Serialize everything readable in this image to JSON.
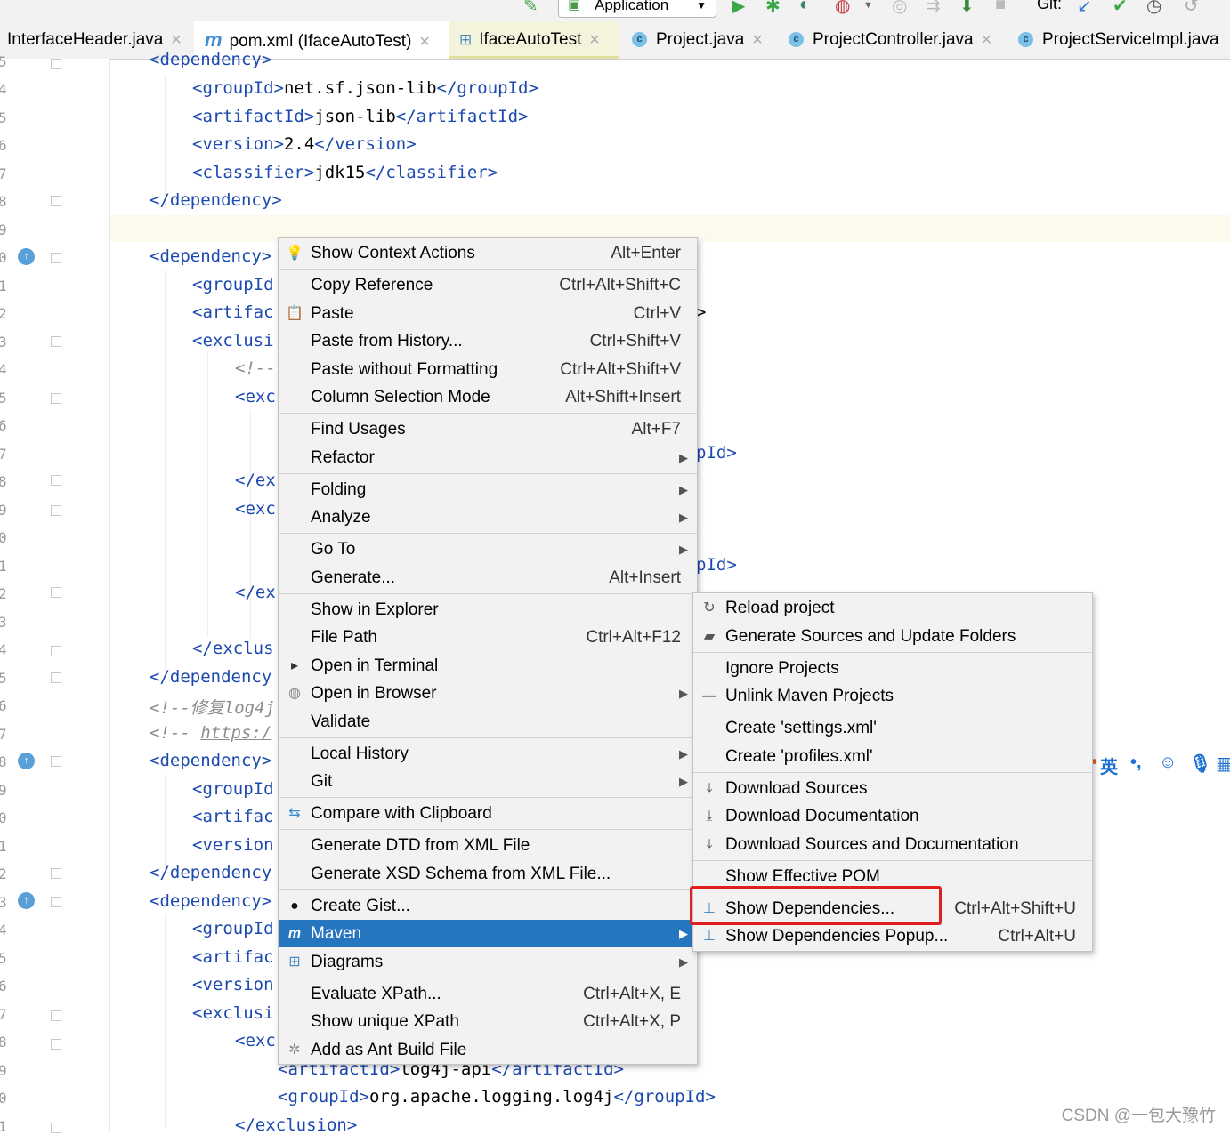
{
  "toolbar": {
    "run_config": "Application",
    "git_label": "Git:"
  },
  "tabs": [
    {
      "label": "InterfaceHeader.java"
    },
    {
      "label": "pom.xml (IfaceAutoTest)"
    },
    {
      "label": "IfaceAutoTest"
    },
    {
      "label": "Project.java"
    },
    {
      "label": "ProjectController.java"
    },
    {
      "label": "ProjectServiceImpl.java"
    }
  ],
  "line_numbers": [
    "5",
    "4",
    "5",
    "6",
    "7",
    "8",
    "9",
    "0",
    "1",
    "2",
    "3",
    "4",
    "5",
    "6",
    "7",
    "8",
    "9",
    "0",
    "1",
    "2",
    "3",
    "4",
    "5",
    "6",
    "7",
    "8",
    "9",
    "0",
    "1",
    "2",
    "3",
    "4",
    "5",
    "6",
    "7",
    "8",
    "9",
    "0",
    "1"
  ],
  "code": {
    "l0": "<dependency>",
    "l1a": "<groupId>",
    "l1b": "net.sf.json-lib",
    "l1c": "</groupId>",
    "l2a": "<artifactId>",
    "l2b": "json-lib",
    "l2c": "</artifactId>",
    "l3a": "<version>",
    "l3b": "2.4",
    "l3c": "</version>",
    "l4a": "<classifier>",
    "l4b": "jdk15",
    "l4c": "</classifier>",
    "l5": "</dependency>",
    "l7": "<dependency>",
    "l8": "<groupId",
    "l9": "<artifac",
    "l10": "<exclusi",
    "l11": "<!--",
    "l12": "<exc",
    "l15": "</ex",
    "l16": "<exc",
    "l19": "</ex",
    "l21": "</exclus",
    "l22": "</dependency",
    "l23": "<!--修复log4j",
    "l24a": "<!-- ",
    "l24b": "https:/",
    "l25": "<dependency>",
    "l26": "<groupId",
    "l27": "<artifac",
    "l28": "<version",
    "l29": "</dependency",
    "l30": "<dependency>",
    "l31": "<groupId",
    "l32": "<artifac",
    "l33": "<version",
    "l34": "<exclusi",
    "l35": "<exc",
    "l36a": "<artifactId>",
    "l36b": "log4j-api",
    "l36c": "</artifactId>",
    "l37a": "<groupId>",
    "l37b": "org.apache.logging.log4j",
    "l37c": "</groupId>",
    "l38": "</exclusion>",
    "frag1": ">",
    "frag2": "pId>",
    "frag3": "pId>"
  },
  "context_menu": [
    {
      "label": "Show Context Actions",
      "shortcut": "Alt+Enter",
      "icon": "bulb-icon"
    },
    {
      "label": "Copy Reference",
      "shortcut": "Ctrl+Alt+Shift+C"
    },
    {
      "label": "Paste",
      "shortcut": "Ctrl+V",
      "icon": "clipboard-icon"
    },
    {
      "label": "Paste from History...",
      "shortcut": "Ctrl+Shift+V"
    },
    {
      "label": "Paste without Formatting",
      "shortcut": "Ctrl+Alt+Shift+V"
    },
    {
      "label": "Column Selection Mode",
      "shortcut": "Alt+Shift+Insert"
    },
    {
      "label": "Find Usages",
      "shortcut": "Alt+F7"
    },
    {
      "label": "Refactor",
      "shortcut": ""
    },
    {
      "label": "Folding",
      "shortcut": ""
    },
    {
      "label": "Analyze",
      "shortcut": ""
    },
    {
      "label": "Go To",
      "shortcut": ""
    },
    {
      "label": "Generate...",
      "shortcut": "Alt+Insert"
    },
    {
      "label": "Show in Explorer",
      "shortcut": ""
    },
    {
      "label": "File Path",
      "shortcut": "Ctrl+Alt+F12"
    },
    {
      "label": "Open in Terminal",
      "shortcut": "",
      "icon": "terminal-icon"
    },
    {
      "label": "Open in Browser",
      "shortcut": "",
      "icon": "globe-icon"
    },
    {
      "label": "Validate",
      "shortcut": ""
    },
    {
      "label": "Local History",
      "shortcut": ""
    },
    {
      "label": "Git",
      "shortcut": ""
    },
    {
      "label": "Compare with Clipboard",
      "shortcut": "",
      "icon": "compare-icon"
    },
    {
      "label": "Generate DTD from XML File",
      "shortcut": ""
    },
    {
      "label": "Generate XSD Schema from XML File...",
      "shortcut": ""
    },
    {
      "label": "Create Gist...",
      "shortcut": "",
      "icon": "github-icon"
    },
    {
      "label": "Maven",
      "shortcut": "",
      "icon": "maven-icon"
    },
    {
      "label": "Diagrams",
      "shortcut": "",
      "icon": "diagram-icon"
    },
    {
      "label": "Evaluate XPath...",
      "shortcut": "Ctrl+Alt+X, E"
    },
    {
      "label": "Show unique XPath",
      "shortcut": "Ctrl+Alt+X, P"
    },
    {
      "label": "Add as Ant Build File",
      "shortcut": "",
      "icon": "ant-icon"
    }
  ],
  "maven_submenu": [
    {
      "label": "Reload project",
      "shortcut": "",
      "icon": "reload-icon"
    },
    {
      "label": "Generate Sources and Update Folders",
      "shortcut": "",
      "icon": "generate-sources-icon"
    },
    {
      "label": "Ignore Projects",
      "shortcut": ""
    },
    {
      "label": "Unlink Maven Projects",
      "shortcut": "",
      "icon": "minus-icon"
    },
    {
      "label": "Create 'settings.xml'",
      "shortcut": ""
    },
    {
      "label": "Create 'profiles.xml'",
      "shortcut": ""
    },
    {
      "label": "Download Sources",
      "shortcut": "",
      "icon": "download-icon"
    },
    {
      "label": "Download Documentation",
      "shortcut": "",
      "icon": "download-icon"
    },
    {
      "label": "Download Sources and Documentation",
      "shortcut": "",
      "icon": "download-icon"
    },
    {
      "label": "Show Effective POM",
      "shortcut": ""
    },
    {
      "label": "Show Dependencies...",
      "shortcut": "Ctrl+Alt+Shift+U",
      "icon": "dependencies-icon"
    },
    {
      "label": "Show Dependencies Popup...",
      "shortcut": "Ctrl+Alt+U",
      "icon": "dependencies-icon"
    }
  ],
  "ime": {
    "lang": "英",
    "punct": "•,"
  },
  "watermark": "CSDN @一包大豫竹",
  "colors": {
    "xml_tag": "#1b49b0",
    "highlight": "#2675bf",
    "annotation_box": "#e02020"
  }
}
